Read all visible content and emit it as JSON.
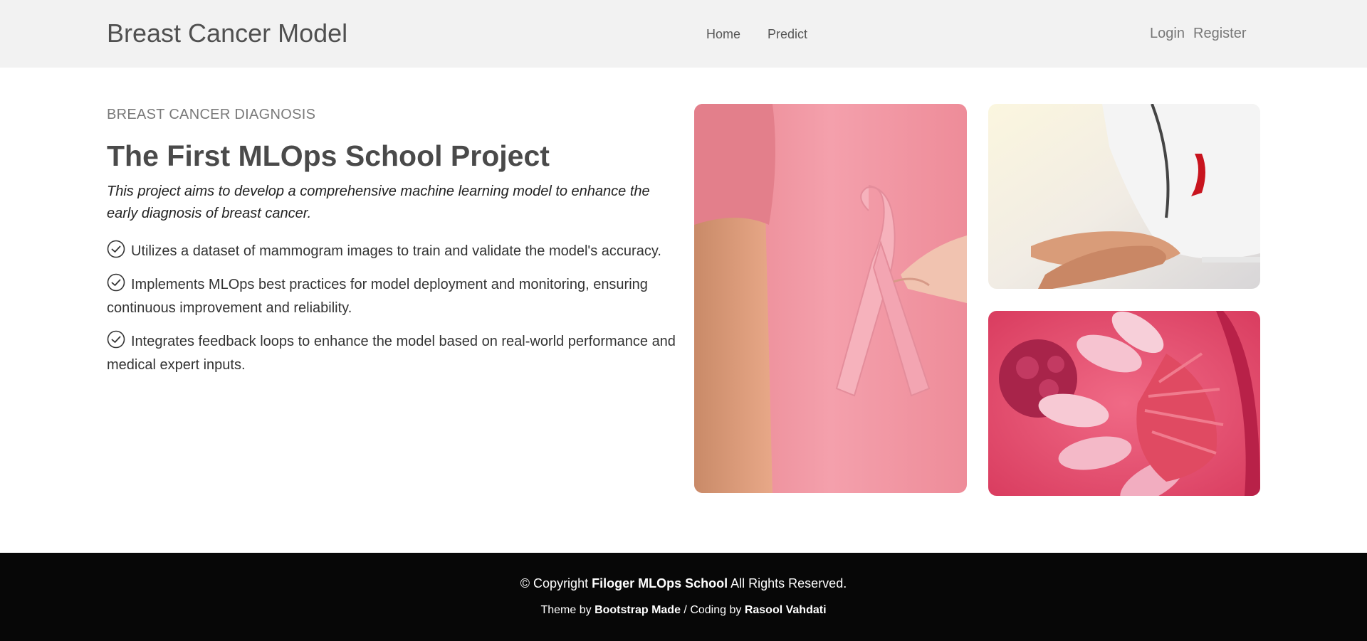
{
  "header": {
    "brand": "Breast Cancer Model",
    "nav": {
      "home": "Home",
      "predict": "Predict"
    },
    "auth": {
      "login": "Login",
      "register": "Register"
    }
  },
  "hero": {
    "eyebrow": "BREAST CANCER DIAGNOSIS",
    "title": "The First MLOps School Project",
    "lead": "This project aims to develop a comprehensive machine learning model to enhance the early diagnosis of breast cancer.",
    "features": [
      "Utilizes a dataset of mammogram images to train and validate the model's accuracy.",
      "Implements MLOps best practices for model deployment and monitoring, ensuring continuous improvement and reliability.",
      "Integrates feedback loops to enhance the model based on real-world performance and medical expert inputs."
    ],
    "images": [
      "pink-ribbon-photo",
      "doctor-holding-patient-hands-photo",
      "breast-tissue-illustration"
    ]
  },
  "footer": {
    "copyright_prefix": "© Copyright",
    "org": "Filoger MLOps School",
    "rights": "All Rights Reserved.",
    "theme_prefix": "Theme by",
    "theme_name": "Bootstrap Made",
    "coding_prefix": "/ Coding by",
    "coder": "Rasool Vahdati"
  },
  "colors": {
    "header_bg": "#f2f2f2",
    "footer_bg": "#070707",
    "title": "#4a4a4a",
    "pink": "#f08ca0"
  }
}
